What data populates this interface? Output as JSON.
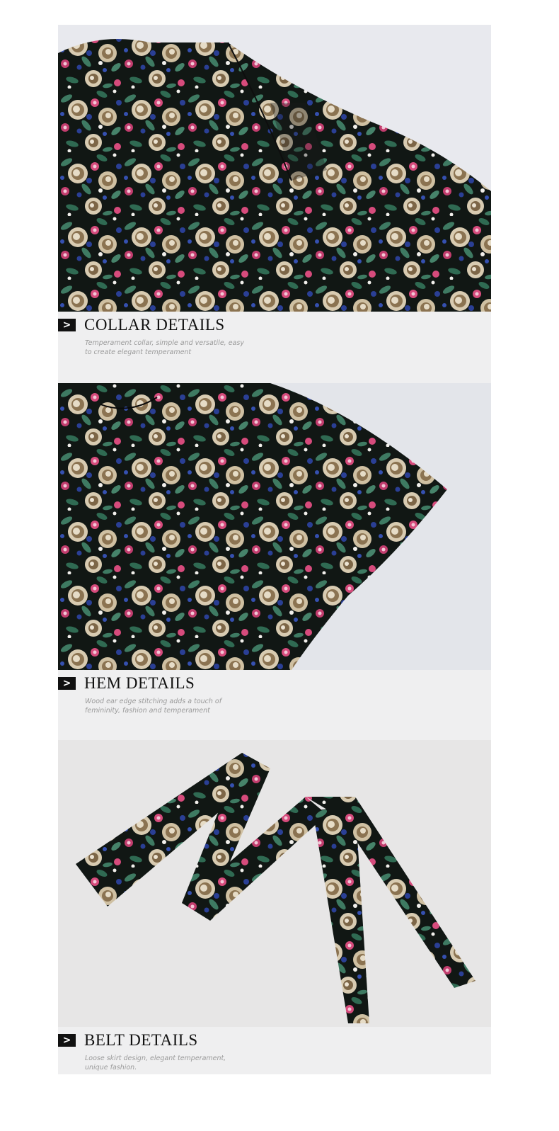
{
  "sections": [
    {
      "title": "COLLAR DETAILS",
      "desc_line1": "Temperament collar, simple and versatile, easy",
      "desc_line2": "to create elegant temperament",
      "arrow": ">",
      "image_subject": "floral-blouse-collar-photo"
    },
    {
      "title": "HEM DETAILS",
      "desc_line1": "Wood ear edge stitching adds a touch of",
      "desc_line2": "femininity, fashion and temperament",
      "arrow": ">",
      "image_subject": "floral-blouse-hem-photo"
    },
    {
      "title": "BELT DETAILS",
      "desc_line1": "Loose skirt design, elegant temperament,",
      "desc_line2": "unique fashion.",
      "arrow": ">",
      "image_subject": "floral-belt-photo"
    }
  ],
  "colors": {
    "panel_bg": "#efeff0",
    "fabric_base": "#111714",
    "rose_beige": "#d8cbb1",
    "rose_brown": "#8b7351",
    "leaf_green": "#3e7a62",
    "flower_pink": "#d64b7c",
    "flower_blue": "#2a3f95"
  }
}
